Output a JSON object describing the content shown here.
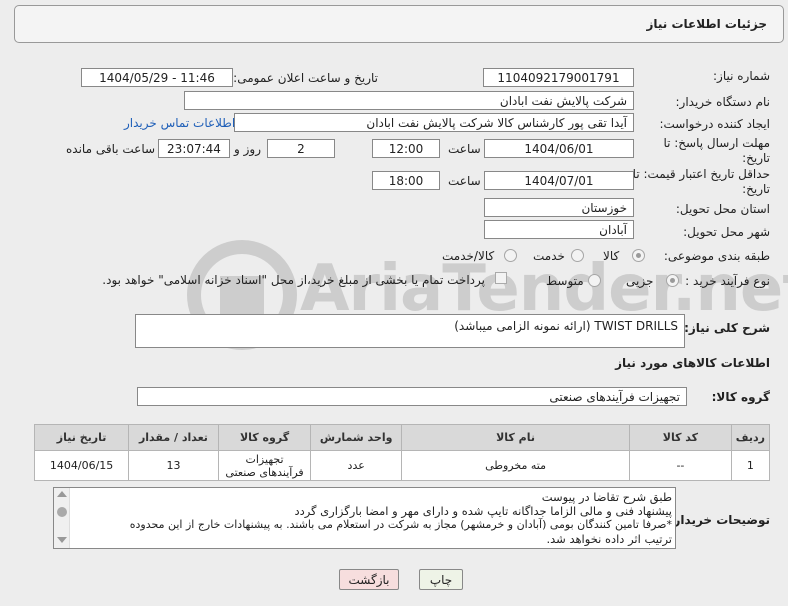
{
  "header": {
    "title": "جزئیات اطلاعات نیاز"
  },
  "need_number": {
    "label": "شماره نیاز:",
    "value": "1104092179001791"
  },
  "announce_date": {
    "label": "تاریخ و ساعت اعلان عمومی:",
    "value": "1404/05/29 - 11:46"
  },
  "buyer_org": {
    "label": "نام دستگاه خریدار:",
    "value": "شرکت پالایش نفت ابادان"
  },
  "requester": {
    "label": "ایجاد کننده درخواست:",
    "value": "آیدا تقی پور کارشناس کالا شرکت پالایش نفت ابادان",
    "contact_link": "اطلاعات تماس خریدار"
  },
  "reply_deadline": {
    "label": "مهلت ارسال پاسخ: تا تاریخ:",
    "date": "1404/06/01",
    "time_label": "ساعت",
    "time": "12:00",
    "days": "2",
    "days_label": "روز و",
    "remaining": "23:07:44",
    "remaining_label": "ساعت باقی مانده"
  },
  "price_validity": {
    "label": "حداقل تاریخ اعتبار قیمت: تا تاریخ:",
    "date": "1404/07/01",
    "time_label": "ساعت",
    "time": "18:00"
  },
  "delivery_province": {
    "label": "استان محل تحویل:",
    "value": "خوزستان"
  },
  "delivery_city": {
    "label": "شهر محل تحویل:",
    "value": "آبادان"
  },
  "category": {
    "label": "طبقه بندی موضوعی:",
    "options": [
      "کالا",
      "خدمت",
      "کالا/خدمت"
    ],
    "selected": "کالا"
  },
  "purchase_process": {
    "label": "نوع فرآیند خرید :",
    "options": [
      "جزیی",
      "متوسط"
    ],
    "selected": "جزیی",
    "payment_note": "پرداخت تمام یا بخشی از مبلغ خرید،از محل \"اسناد خزانه اسلامی\" خواهد بود."
  },
  "description": {
    "label": "شرح کلی نیاز:",
    "value": "TWIST DRILLS (ارائه نمونه الزامی میباشد)"
  },
  "goods_section_title": "اطلاعات کالاهای مورد نیاز",
  "goods_group": {
    "label": "گروه کالا:",
    "value": "تجهیزات فرآیندهای صنعتی"
  },
  "table": {
    "headers": [
      "ردیف",
      "کد کالا",
      "نام کالا",
      "واحد شمارش",
      "گروه کالا",
      "تعداد / مقدار",
      "تاریخ نیاز"
    ],
    "rows": [
      [
        "1",
        "--",
        "مته مخروطی",
        "عدد",
        "تجهیزات فرآیندهای صنعتی",
        "13",
        "1404/06/15"
      ]
    ]
  },
  "buyer_notes": {
    "label": "توضیحات خریدار:",
    "lines": [
      "طبق شرح تقاضا در پیوست",
      "پیشنهاد فنی و مالی الزاما جداگانه تایپ شده و دارای مهر و امضا بارگزاری گردد",
      "*صرفا تامین کنندگان بومی (آبادان و خرمشهر) مجاز به شرکت در استعلام می باشند. به پیشنهادات خارج از این محدوده",
      "ترتیب اثر داده نخواهد شد."
    ]
  },
  "buttons": {
    "print": "چاپ",
    "back": "بازگشت"
  },
  "watermark": "AriaTender.net"
}
